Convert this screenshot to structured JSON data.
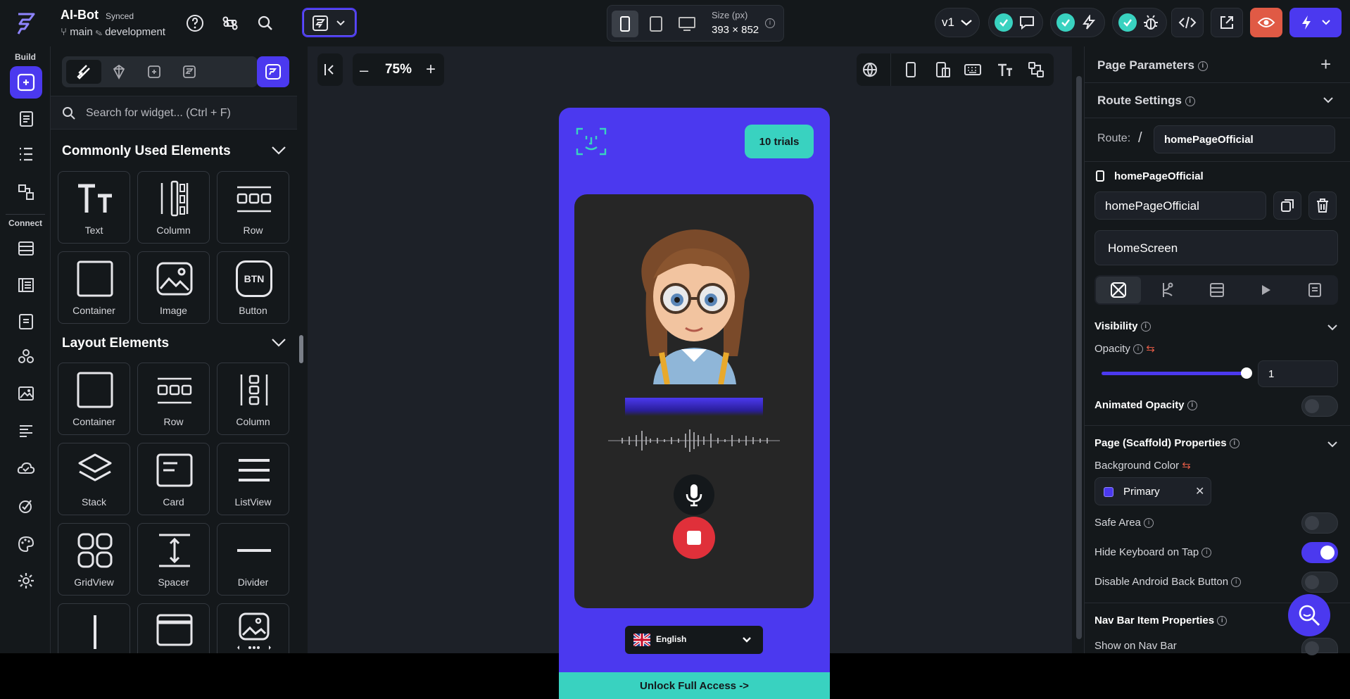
{
  "project": {
    "name": "AI-Bot",
    "sync_status": "Synced",
    "branch": "main",
    "environment": "development"
  },
  "device": {
    "size_label": "Size (px)",
    "size_value": "393 × 852"
  },
  "version": {
    "label": "v1"
  },
  "rail": {
    "build_label": "Build",
    "connect_label": "Connect"
  },
  "widget_panel": {
    "search_placeholder": "Search for widget... (Ctrl + F)",
    "sections": [
      {
        "title": "Commonly Used Elements",
        "items": [
          "Text",
          "Column",
          "Row",
          "Container",
          "Image",
          "Button"
        ]
      },
      {
        "title": "Layout Elements",
        "items": [
          "Container",
          "Row",
          "Column",
          "Stack",
          "Card",
          "ListView",
          "GridView",
          "Spacer",
          "Divider"
        ]
      }
    ],
    "button_glyph_text": "BTN"
  },
  "canvas": {
    "zoom": "75%",
    "phone": {
      "trials_label": "10 trials",
      "language": "English",
      "unlock_label": "Unlock Full Access ->"
    }
  },
  "properties": {
    "page_parameters": "Page Parameters",
    "route_settings": "Route Settings",
    "route_label": "Route:",
    "route_slash": "/",
    "route_value": "homePageOfficial",
    "page_name_heading": "homePageOfficial",
    "page_name_value": "homePageOfficial",
    "screen_name": "HomeScreen",
    "visibility": "Visibility",
    "opacity_label": "Opacity",
    "opacity_value": "1",
    "animated_opacity": "Animated Opacity",
    "scaffold_title": "Page (Scaffold) Properties",
    "background_color_label": "Background Color",
    "background_color_value": "Primary",
    "safe_area": "Safe Area",
    "hide_keyboard": "Hide Keyboard on Tap",
    "disable_back": "Disable Android Back Button",
    "nav_bar_title": "Nav Bar Item Properties",
    "show_on_nav_bar": "Show on Nav Bar"
  },
  "colors": {
    "primary": "#4b39ef",
    "accent": "#39d2c0",
    "stop": "#e0303a"
  }
}
